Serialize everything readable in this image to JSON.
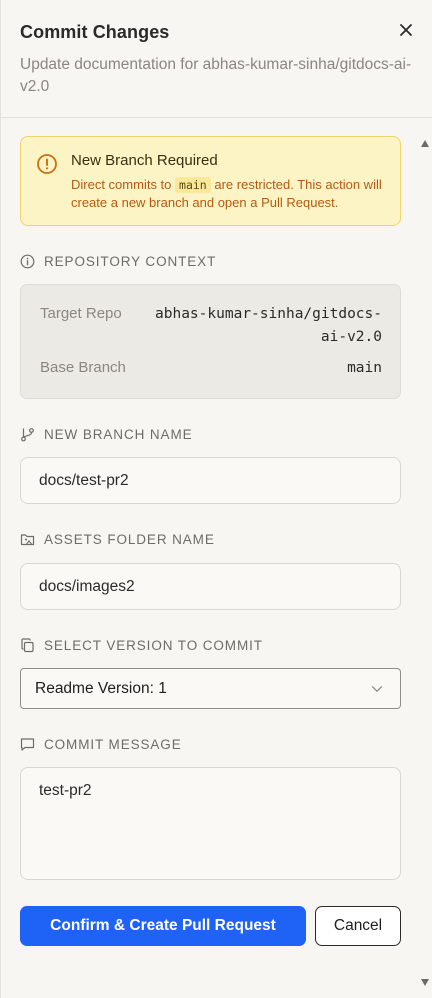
{
  "dialog": {
    "title": "Commit Changes",
    "subtitle": "Update documentation for abhas-kumar-sinha/gitdocs-ai-v2.0",
    "close_icon": "close-icon"
  },
  "alert": {
    "icon": "warning-circle-icon",
    "title": "New Branch Required",
    "text_before": "Direct commits to",
    "code": "main",
    "text_after": "are restricted. This action will create a new branch and open a Pull Request.",
    "colors": {
      "background": "#fdf4c5",
      "border": "#efd46a",
      "text": "#b55a10"
    }
  },
  "repository_context": {
    "label": "REPOSITORY CONTEXT",
    "icon": "info-icon",
    "target_repo_label": "Target Repo",
    "target_repo_value_line1": "abhas-kumar-sinha/gitdocs-",
    "target_repo_value_line2": "ai-v2.0",
    "base_branch_label": "Base Branch",
    "base_branch_value": "main"
  },
  "new_branch": {
    "label": "NEW BRANCH NAME",
    "icon": "git-branch-icon",
    "value": "docs/test-pr2"
  },
  "assets_folder": {
    "label": "ASSETS FOLDER NAME",
    "icon": "folder-image-icon",
    "value": "docs/images2"
  },
  "version_select": {
    "label": "SELECT VERSION TO COMMIT",
    "icon": "copy-icon",
    "selected": "Readme Version: 1"
  },
  "commit_message": {
    "label": "COMMIT MESSAGE",
    "icon": "message-square-icon",
    "value": "test-pr2"
  },
  "actions": {
    "confirm_label": "Confirm & Create Pull Request",
    "cancel_label": "Cancel",
    "accent": "#1e63f5"
  }
}
